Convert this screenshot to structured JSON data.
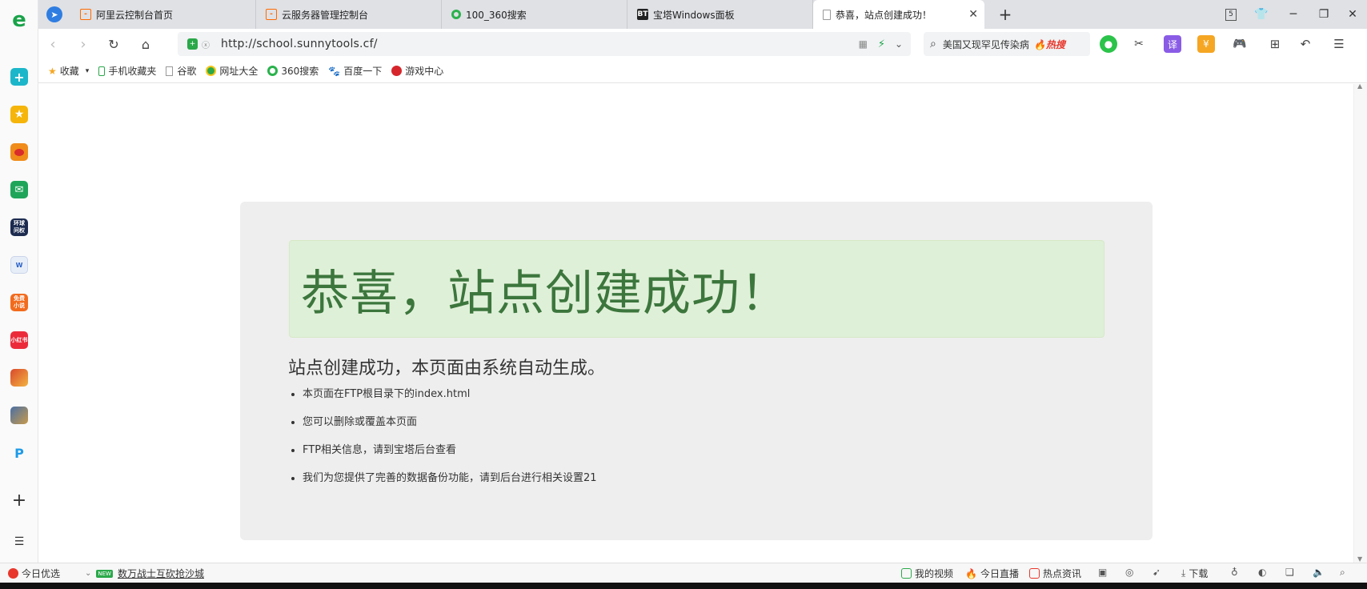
{
  "tabs": [
    {
      "label": "阿里云控制台首页",
      "icon": "aliyun-icon"
    },
    {
      "label": "云服务器管理控制台",
      "icon": "aliyun-icon"
    },
    {
      "label": "100_360搜索",
      "icon": "360-search-icon"
    },
    {
      "label": "宝塔Windows面板",
      "icon": "bt-icon",
      "icon_text": "BT"
    },
    {
      "label": "恭喜，站点创建成功！",
      "icon": "page-icon",
      "active": true
    }
  ],
  "tab_counter": "5",
  "address": {
    "url": "http://school.sunnytools.cf/"
  },
  "search": {
    "query": "美国又现罕见传染病",
    "hot_label": "热搜"
  },
  "bookmarks": [
    {
      "label": "收藏",
      "icon": "star-icon"
    },
    {
      "label": "手机收藏夹",
      "icon": "phone-icon"
    },
    {
      "label": "谷歌",
      "icon": "page-icon"
    },
    {
      "label": "网址大全",
      "icon": "globe-icon"
    },
    {
      "label": "360搜索",
      "icon": "360-search-icon"
    },
    {
      "label": "百度一下",
      "icon": "baidu-icon"
    },
    {
      "label": "游戏中心",
      "icon": "game-icon"
    }
  ],
  "sidebar": {
    "items": [
      {
        "name": "browser-logo-icon",
        "text": "e"
      },
      {
        "name": "medical-cross-icon",
        "text": "+"
      },
      {
        "name": "favorites-star-icon",
        "text": "★"
      },
      {
        "name": "weibo-icon",
        "text": ""
      },
      {
        "name": "mail-icon",
        "text": "✉"
      },
      {
        "name": "global-ask-icon",
        "text": "环球问权"
      },
      {
        "name": "word-doc-icon",
        "text": "W"
      },
      {
        "name": "free-novel-icon",
        "text": "免费小说"
      },
      {
        "name": "xiaohongshu-icon",
        "text": "小红书"
      },
      {
        "name": "game-character-icon",
        "text": ""
      },
      {
        "name": "pubg-game-icon",
        "text": ""
      },
      {
        "name": "pi-app-icon",
        "text": "P"
      },
      {
        "name": "add-icon",
        "text": "+"
      },
      {
        "name": "list-icon",
        "text": "☰"
      }
    ]
  },
  "page": {
    "alert_title": "恭喜，站点创建成功！",
    "lead": "站点创建成功，本页面由系统自动生成。",
    "items": [
      "本页面在FTP根目录下的index.html",
      "您可以删除或覆盖本页面",
      "FTP相关信息，请到宝塔后台查看",
      "我们为您提供了完善的数据备份功能，请到后台进行相关设置21"
    ]
  },
  "statusbar": {
    "left": [
      {
        "label": "今日优选",
        "icon": "heart-icon"
      },
      {
        "label": "数万战士互砍抢沙城",
        "badge": "NEW"
      }
    ],
    "right": [
      {
        "label": "我的视频",
        "icon": "video-icon"
      },
      {
        "label": "今日直播",
        "icon": "fire-icon"
      },
      {
        "label": "热点资讯",
        "icon": "news-icon"
      },
      {
        "label": "下载",
        "icon": "download-icon"
      }
    ]
  },
  "colors": {
    "alert_bg": "#dff0d8",
    "alert_text": "#3c763d",
    "jumbotron_bg": "#eeeeee",
    "tab_bar": "#dfe1e5"
  }
}
